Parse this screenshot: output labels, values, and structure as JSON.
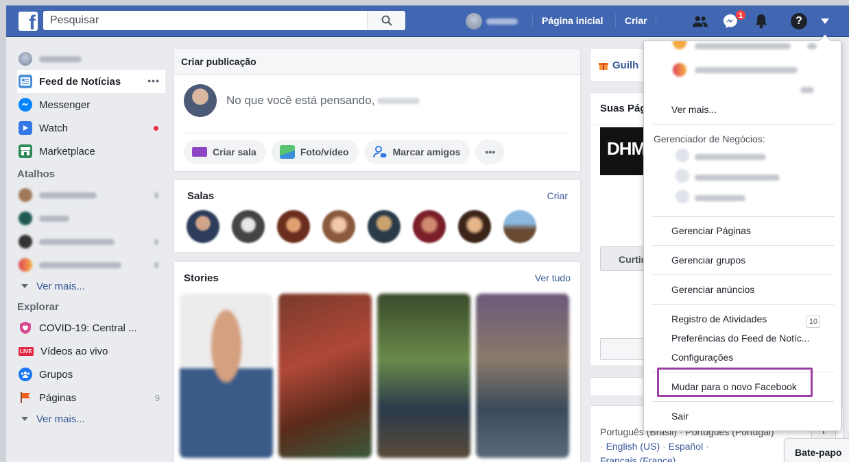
{
  "topbar": {
    "search_placeholder": "Pesquisar",
    "home_link": "Página inicial",
    "create_link": "Criar",
    "messages_badge": "1"
  },
  "sidebar": {
    "items": [
      {
        "label": "Feed de Notícias",
        "more": "•••"
      },
      {
        "label": "Messenger"
      },
      {
        "label": "Watch"
      },
      {
        "label": "Marketplace"
      }
    ],
    "shortcuts_title": "Atalhos",
    "shortcuts_more": "Ver mais...",
    "explore_title": "Explorar",
    "explore": [
      {
        "label": "COVID-19: Central ..."
      },
      {
        "label": "Vídeos ao vivo",
        "badge": "LIVE"
      },
      {
        "label": "Grupos"
      },
      {
        "label": "Páginas",
        "count": "9"
      }
    ],
    "explore_more": "Ver mais..."
  },
  "composer": {
    "title": "Criar publicação",
    "placeholder": "No que você está pensando,",
    "buttons": [
      "Criar sala",
      "Foto/vídeo",
      "Marcar amigos",
      "•••"
    ]
  },
  "rooms": {
    "title": "Salas",
    "action": "Criar"
  },
  "stories": {
    "title": "Stories",
    "action": "Ver tudo"
  },
  "right": {
    "gift_label": "Guilh",
    "pages_title": "Suas Pág",
    "page_logo": "DHM",
    "like_button": "Curtir",
    "languages": {
      "line1": "Português (Brasil) · Português (Portugal)",
      "english": "English (US)",
      "spanish": "Español",
      "french": "Français (France)"
    },
    "add_language": "+"
  },
  "chat": {
    "label": "Bate-papo"
  },
  "dropdown": {
    "see_more": "Ver mais...",
    "business_manager": "Gerenciador de Negócios:",
    "manage_pages": "Gerenciar Páginas",
    "manage_groups": "Gerenciar grupos",
    "manage_ads": "Gerenciar anúncios",
    "activity_log": "Registro de Atividades",
    "activity_count": "10",
    "feed_prefs": "Preferências do Feed de Notíc...",
    "settings": "Configurações",
    "switch_new": "Mudar para o novo Facebook",
    "logout": "Sair"
  },
  "colors": {
    "brand": "#4267b2",
    "highlight": "#9b3ea3",
    "link": "#385898"
  }
}
